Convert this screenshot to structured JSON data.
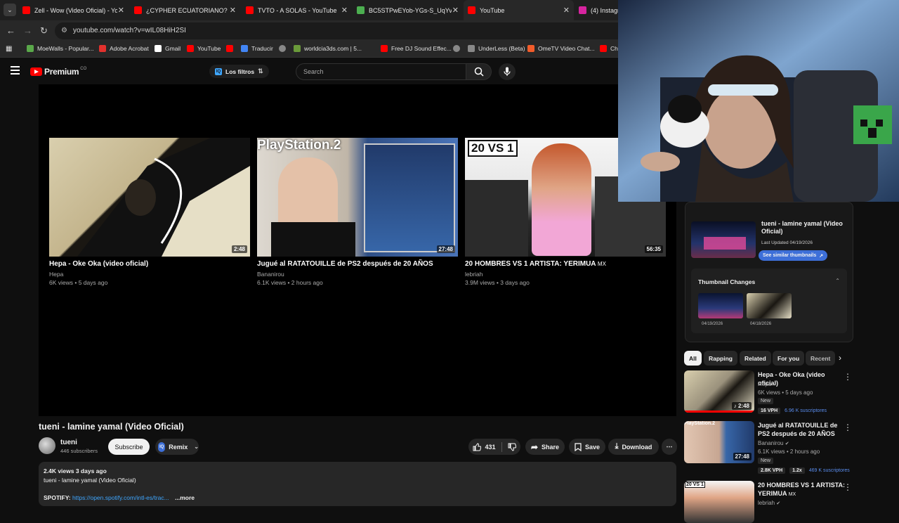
{
  "browser": {
    "tabs": [
      {
        "title": "Zell - Wow (Video Oficial) - You",
        "color": "#ff0000"
      },
      {
        "title": "¿CYPHER ECUATORIANO? | INS",
        "color": "#ff0000"
      },
      {
        "title": "TVTO - A SOLAS - YouTube",
        "color": "#ff0000"
      },
      {
        "title": "BC5STPwEYob-YGs-S_UqYvugw",
        "color": "#4caf50"
      },
      {
        "title": "YouTube",
        "color": "#ff0000"
      },
      {
        "title": "(4) Instagram",
        "color": "#d6249f"
      }
    ],
    "url": "youtube.com/watch?v=wIL08HiH2SI",
    "bookmarks": [
      {
        "label": "MoeWalls - Popular...",
        "color": "#5aa84a"
      },
      {
        "label": "Adobe Acrobat",
        "color": "#e3312d"
      },
      {
        "label": "Gmail",
        "color": "#ffffff"
      },
      {
        "label": "YouTube",
        "color": "#ff0000"
      },
      {
        "label": "",
        "color": "#ff0000"
      },
      {
        "label": "Traducir",
        "color": "#4285f4"
      },
      {
        "label": "",
        "color": "#888888"
      },
      {
        "label": "worldcia3ds.com | 5...",
        "color": "#6a9a3a"
      },
      {
        "label": "Free DJ Sound Effec...",
        "color": "#ff0000"
      },
      {
        "label": "",
        "color": "#888888"
      },
      {
        "label": "UnderLess (Beta)",
        "color": "#888888"
      },
      {
        "label": "OmeTV Video Chat...",
        "color": "#f25c2a"
      },
      {
        "label": "Ch",
        "color": "#ff0000"
      }
    ]
  },
  "header": {
    "logo_text": "Premium",
    "logo_sup": "CO",
    "filters_label": "Los filtros",
    "search_placeholder": "Search"
  },
  "endscreen": [
    {
      "title": "Hepa - Oke Oka (video oficial)",
      "channel": "Hepa",
      "meta": "6K views • 5 days ago",
      "duration": "2:48"
    },
    {
      "title": "Jugué al RATATOUILLE de PS2 después de 20 AÑOS",
      "channel": "Bananirou",
      "meta": "6.1K views • 2 hours ago",
      "duration": "27:48",
      "overlay_text": "PlayStation.2"
    },
    {
      "title": "20 HOMBRES VS 1 ARTISTA: YERIMUA",
      "title_suffix": "MX",
      "channel": "lebriah",
      "meta": "3.9M views • 3 days ago",
      "duration": "56:35",
      "overlay_text": "20 VS 1"
    }
  ],
  "video": {
    "title": "tueni - lamine yamal (Video Oficial)",
    "channel": "tueni",
    "subscribers": "446 subscribers",
    "subscribe_label": "Subscribe",
    "remix_label": "Remix",
    "likes": "431",
    "share_label": "Share",
    "save_label": "Save",
    "download_label": "Download",
    "desc_meta": "2.4K views  3 days ago",
    "desc_line": "tueni - lamine yamal (Video Oficial)",
    "desc_spotify_label": "SPOTIFY:",
    "desc_spotify_link": "https://open.spotify.com/intl-es/trac...",
    "desc_more": "...more"
  },
  "ext_panel": {
    "card_title": "tueni - lamine yamal (Video Oficial)",
    "last_updated": "Last Updated 04/19/2026",
    "similar_btn": "See similar thumbnails",
    "changes_title": "Thumbnail Changes",
    "change_dates": [
      "04/19/2026",
      "04/18/2026"
    ]
  },
  "chips": [
    "All",
    "Rapping",
    "Related",
    "For you",
    "Recent"
  ],
  "recs": [
    {
      "title": "Hepa - Oke Oka (video oficial)",
      "channel": "Hepa",
      "meta": "6K views • 5 days ago",
      "duration": "2:48",
      "tag": "New",
      "vph": "16 VPH",
      "subs": "6.96 K suscriptores"
    },
    {
      "title": "Jugué al RATATOUILLE de PS2 después de 20 AÑOS",
      "channel": "Bananirou",
      "meta": "6.1K views • 2 hours ago",
      "duration": "27:48",
      "tag": "New",
      "vph": "2.8K VPH",
      "ratio": "1.2x",
      "subs": "469 K suscriptores"
    },
    {
      "title": "20 HOMBRES VS 1 ARTISTA: YERIMUA",
      "title_suffix": "MX",
      "channel": "lebriah"
    }
  ]
}
